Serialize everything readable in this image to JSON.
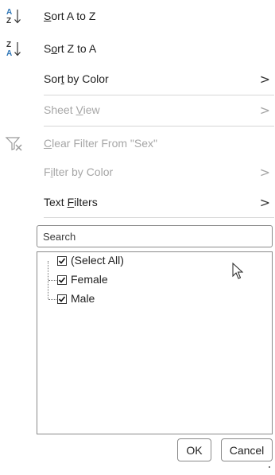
{
  "menu": {
    "sort_az": {
      "before": "",
      "access": "S",
      "after": "ort A to Z",
      "icon": "sort-a-to-z-icon"
    },
    "sort_za": {
      "before": "S",
      "access": "o",
      "after": "rt Z to A",
      "icon": "sort-z-to-a-icon"
    },
    "sort_color": {
      "before": "Sor",
      "access": "t",
      "after": " by Color",
      "chevron": ">"
    },
    "sheet_view": {
      "before": "Sheet ",
      "access": "V",
      "after": "iew",
      "chevron": ">"
    },
    "clear_filter": {
      "before": "",
      "access": "C",
      "after": "lear Filter From \"Sex\"",
      "icon": "clear-filter-icon"
    },
    "filter_color": {
      "before": "F",
      "access": "i",
      "after": "lter by Color",
      "chevron": ">"
    },
    "text_filters": {
      "before": "Text ",
      "access": "F",
      "after": "ilters",
      "chevron": ">"
    }
  },
  "search": {
    "placeholder": "Search"
  },
  "list": {
    "select_all": "(Select All)",
    "items": [
      "Female",
      "Male"
    ]
  },
  "buttons": {
    "ok": "OK",
    "cancel": "Cancel"
  },
  "colors": {
    "accent": "#1f1f1f",
    "disabled": "#a6a6a6",
    "sort_blue": "#2e75b6"
  }
}
